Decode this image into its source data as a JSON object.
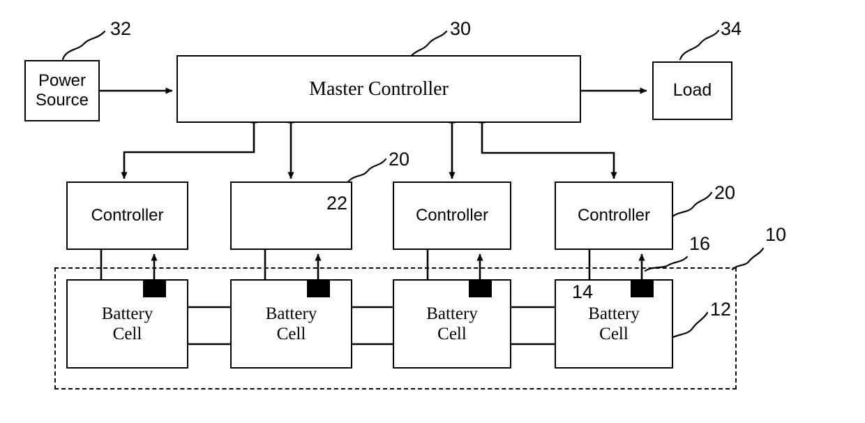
{
  "diagram": {
    "title": "Battery management system block diagram",
    "stroke_color": "#000000",
    "background_color": "#ffffff"
  },
  "blocks": {
    "power_source": {
      "label": "Power\nSource",
      "line1": "Power",
      "line2": "Source"
    },
    "master_controller": {
      "label": "Master Controller"
    },
    "load": {
      "label": "Load"
    },
    "controllers": [
      {
        "label": "Controller"
      },
      {
        "label": ""
      },
      {
        "label": "Controller"
      },
      {
        "label": "Controller"
      }
    ],
    "cells": [
      {
        "line1": "Battery",
        "line2": "Cell"
      },
      {
        "line1": "Battery",
        "line2": "Cell"
      },
      {
        "line1": "Battery",
        "line2": "Cell"
      },
      {
        "line1": "Battery",
        "line2": "Cell"
      }
    ]
  },
  "reference_numerals": {
    "n32": "32",
    "n30": "30",
    "n34": "34",
    "n20a": "20",
    "n22": "22",
    "n20b": "20",
    "n16": "16",
    "n10": "10",
    "n14": "14",
    "n12": "12"
  },
  "symbols": {
    "sensor_icon": "thermistor-sensor",
    "switch_icon": "variable-resistor-symbol"
  }
}
